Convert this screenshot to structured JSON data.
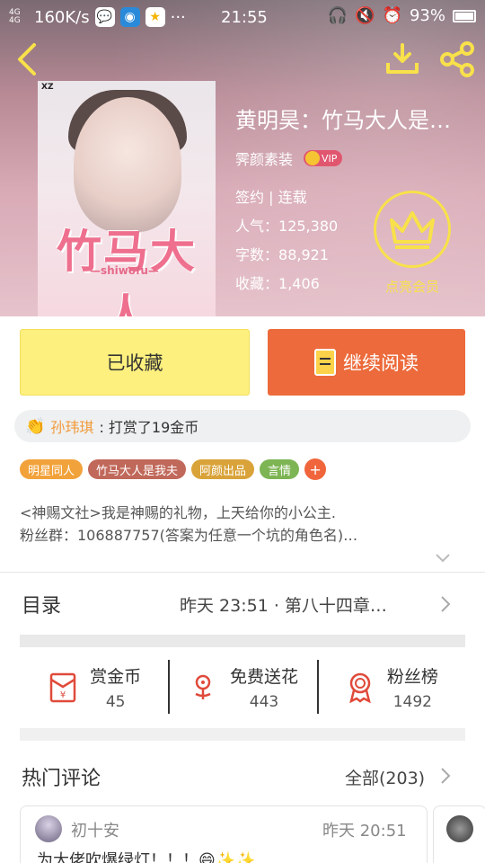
{
  "status_bar": {
    "network": "4G 4G",
    "speed": "160K/s",
    "time": "21:55",
    "battery": "93%"
  },
  "book": {
    "title": "黄明昊：竹马大人是…",
    "author": "霁颜素装",
    "vip_label": "VIP",
    "status": "签约 | 连载",
    "popularity_label": "人气：",
    "popularity": "125,380",
    "words_label": "字数：",
    "words": "88,921",
    "favorites_label": "收藏：",
    "favorites": "1,406",
    "member_label": "点亮会员"
  },
  "cover": {
    "publisher": "XZ",
    "title": "竹马大人",
    "subtitle": "—shiwofu—"
  },
  "actions": {
    "favorited": "已收藏",
    "continue_reading": "继续阅读"
  },
  "tip": {
    "user": "孙玮琪",
    "text": ": 打赏了19金币"
  },
  "tags": [
    {
      "label": "明星同人",
      "color": "#f2a23a"
    },
    {
      "label": "竹马大人是我夫",
      "color": "#c0685a"
    },
    {
      "label": "阿颜出品",
      "color": "#d9a33a"
    },
    {
      "label": "言情",
      "color": "#7db554"
    }
  ],
  "tag_more": "+",
  "synopsis": {
    "line1": "<神赐文社>我是神赐的礼物，上天给你的小公主.",
    "line2": "粉丝群：106887757(答案为任意一个坑的角色名)…"
  },
  "toc": {
    "label": "目录",
    "latest": "昨天 23:51 · 第八十四章…"
  },
  "stats": [
    {
      "label": "赏金币",
      "value": "45",
      "icon": "red-envelope-icon"
    },
    {
      "label": "免费送花",
      "value": "443",
      "icon": "flower-icon"
    },
    {
      "label": "粉丝榜",
      "value": "1492",
      "icon": "medal-icon"
    }
  ],
  "comments": {
    "header": "热门评论",
    "all": "全部(203)",
    "items": [
      {
        "user": "初十安",
        "time": "昨天 20:51",
        "text": "为大佬吹爆绿灯！！！😄✨✨"
      }
    ]
  },
  "colors": {
    "favorite_bg": "#fdf07e",
    "read_bg": "#ec6a3b",
    "tip_user": "#f29a3b",
    "crown": "#f8e14a",
    "icon_red": "#e04a3a"
  }
}
